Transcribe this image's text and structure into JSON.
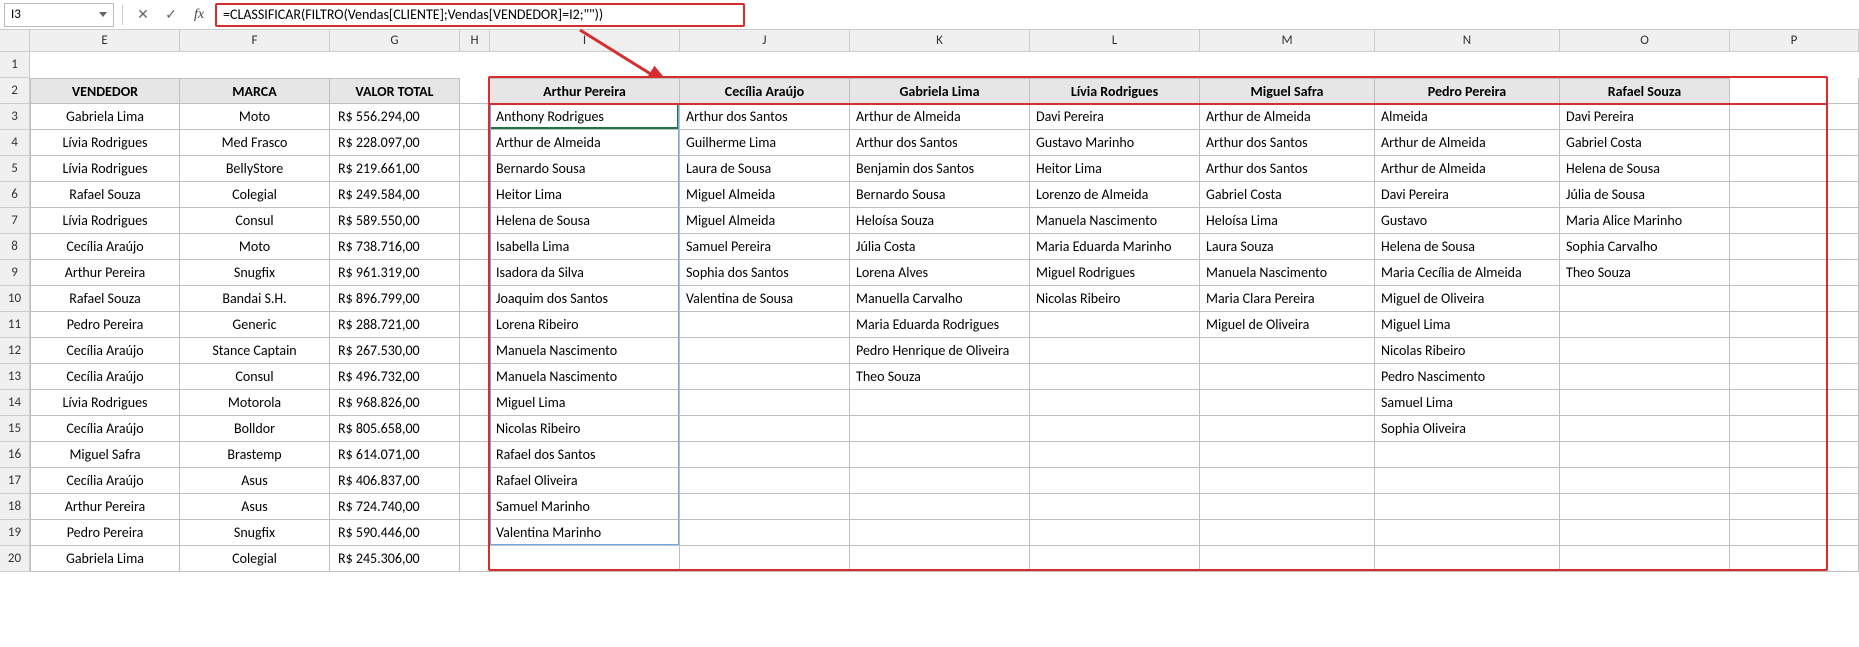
{
  "namebox": "I3",
  "formula": "=CLASSIFICAR(FILTRO(Vendas[CLIENTE];Vendas[VENDEDOR]=I2;\"\"))",
  "columns": [
    "E",
    "F",
    "G",
    "H",
    "I",
    "J",
    "K",
    "L",
    "M",
    "N",
    "O",
    "P"
  ],
  "row_numbers": [
    "1",
    "2",
    "3",
    "4",
    "5",
    "6",
    "7",
    "8",
    "9",
    "10",
    "11",
    "12",
    "13",
    "14",
    "15",
    "16",
    "17",
    "18",
    "19",
    "20"
  ],
  "left_table": {
    "headers": [
      "VENDEDOR",
      "MARCA",
      "VALOR TOTAL"
    ],
    "rows": [
      [
        "Gabriela Lima",
        "Moto",
        "R$   556.294,00"
      ],
      [
        "Lívia Rodrigues",
        "Med Frasco",
        "R$   228.097,00"
      ],
      [
        "Lívia Rodrigues",
        "BellyStore",
        "R$   219.661,00"
      ],
      [
        "Rafael Souza",
        "Colegial",
        "R$   249.584,00"
      ],
      [
        "Lívia Rodrigues",
        "Consul",
        "R$   589.550,00"
      ],
      [
        "Cecília Araújo",
        "Moto",
        "R$   738.716,00"
      ],
      [
        "Arthur Pereira",
        "Snugfix",
        "R$   961.319,00"
      ],
      [
        "Rafael Souza",
        "Bandai S.H.",
        "R$   896.799,00"
      ],
      [
        "Pedro Pereira",
        "Generic",
        "R$   288.721,00"
      ],
      [
        "Cecília Araújo",
        "Stance Captain",
        "R$   267.530,00"
      ],
      [
        "Cecília Araújo",
        "Consul",
        "R$   496.732,00"
      ],
      [
        "Lívia Rodrigues",
        "Motorola",
        "R$   968.826,00"
      ],
      [
        "Cecília Araújo",
        "Bolldor",
        "R$   805.658,00"
      ],
      [
        "Miguel Safra",
        "Brastemp",
        "R$   614.071,00"
      ],
      [
        "Cecília Araújo",
        "Asus",
        "R$   406.837,00"
      ],
      [
        "Arthur Pereira",
        "Asus",
        "R$   724.740,00"
      ],
      [
        "Pedro Pereira",
        "Snugfix",
        "R$   590.446,00"
      ],
      [
        "Gabriela Lima",
        "Colegial",
        "R$   245.306,00"
      ]
    ]
  },
  "right_headers": [
    "Arthur Pereira",
    "Cecília Araújo",
    "Gabriela Lima",
    "Lívia Rodrigues",
    "Miguel Safra",
    "Pedro Pereira",
    "Rafael Souza"
  ],
  "right_data": {
    "I": [
      "Anthony Rodrigues",
      "Arthur de Almeida",
      "Bernardo Sousa",
      "Heitor Lima",
      "Helena de Sousa",
      "Isabella Lima",
      "Isadora da Silva",
      "Joaquim dos Santos",
      "Lorena Ribeiro",
      "Manuela Nascimento",
      "Manuela Nascimento",
      "Miguel Lima",
      "Nicolas Ribeiro",
      "Rafael dos Santos",
      "Rafael Oliveira",
      "Samuel Marinho",
      "Valentina Marinho"
    ],
    "J": [
      "Arthur dos Santos",
      "Guilherme Lima",
      "Laura de Sousa",
      "Miguel Almeida",
      "Miguel Almeida",
      "Samuel Pereira",
      "Sophia dos Santos",
      "Valentina de Sousa"
    ],
    "K": [
      "Arthur de Almeida",
      "Arthur dos Santos",
      "Benjamin dos Santos",
      "Bernardo Sousa",
      "Heloísa Souza",
      "Júlia Costa",
      "Lorena Alves",
      "Manuella Carvalho",
      "Maria Eduarda Rodrigues",
      "Pedro Henrique de Oliveira",
      "Theo Souza"
    ],
    "L": [
      "Davi Pereira",
      "Gustavo Marinho",
      "Heitor Lima",
      "Lorenzo de Almeida",
      "Manuela Nascimento",
      "Maria Eduarda Marinho",
      "Miguel Rodrigues",
      "Nicolas Ribeiro"
    ],
    "M": [
      "Arthur de Almeida",
      "Arthur dos Santos",
      "Arthur dos Santos",
      "Gabriel Costa",
      "Heloísa Lima",
      "Laura Souza",
      "Manuela Nascimento",
      "Maria Clara Pereira",
      "Miguel de Oliveira"
    ],
    "N": [
      " Almeida",
      "Arthur de Almeida",
      "Arthur de Almeida",
      "Davi Pereira",
      "Gustavo",
      "Helena de Sousa",
      "Maria Cecília de Almeida",
      "Miguel de Oliveira",
      "Miguel Lima",
      "Nicolas Ribeiro",
      "Pedro Nascimento",
      "Samuel Lima",
      "Sophia Oliveira"
    ],
    "O": [
      "Davi Pereira",
      "Gabriel Costa",
      "Helena de Sousa",
      "Júlia de Sousa",
      "Maria Alice Marinho",
      "Sophia Carvalho",
      "Theo Souza"
    ]
  }
}
